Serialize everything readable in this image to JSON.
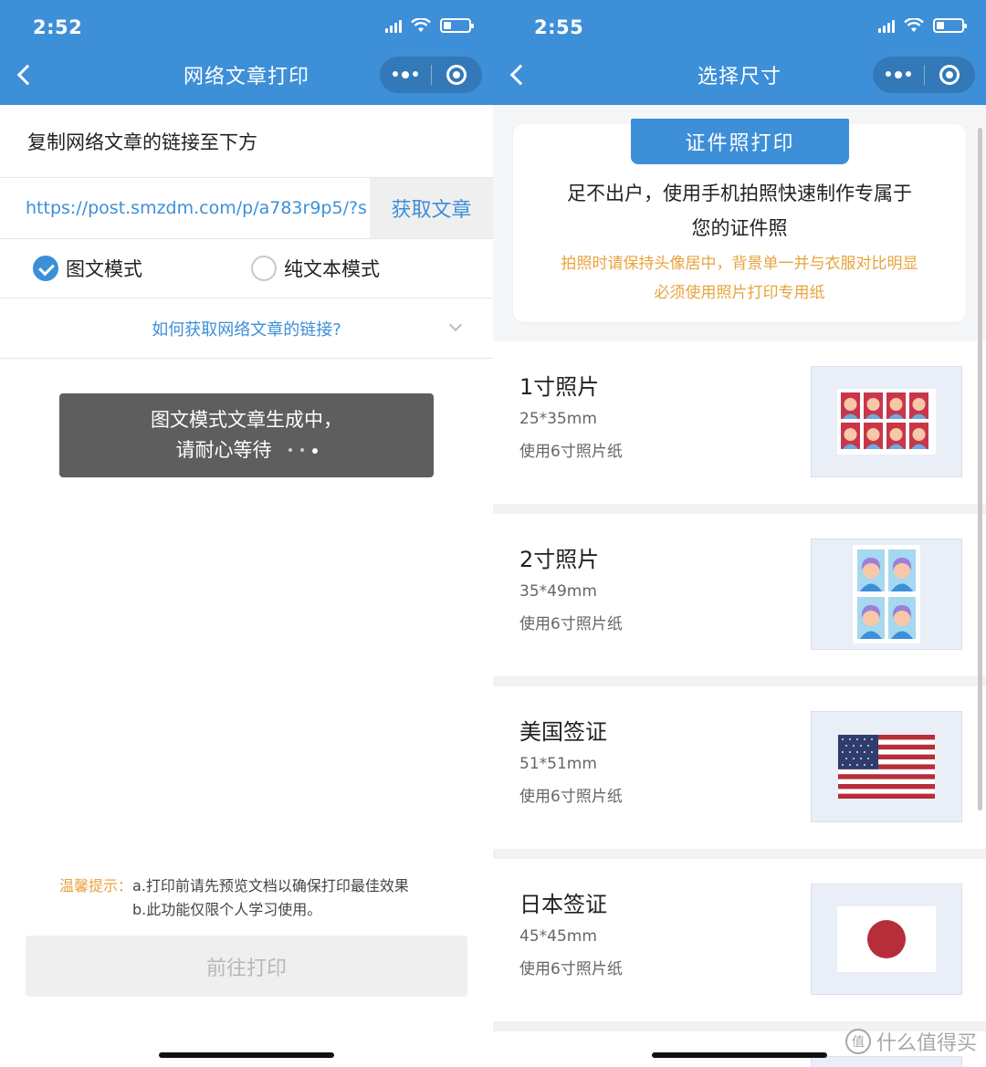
{
  "left": {
    "status": {
      "time": "2:52"
    },
    "nav": {
      "title": "网络文章打印"
    },
    "copy_label": "复制网络文章的链接至下方",
    "url_input": {
      "value": "https://post.smzdm.com/p/a783r9p5/?s"
    },
    "fetch_button": "获取文章",
    "modes": [
      {
        "label": "图文模式",
        "selected": true
      },
      {
        "label": "纯文本模式",
        "selected": false
      }
    ],
    "howto_link": "如何获取网络文章的链接?",
    "toast": {
      "line1": "图文模式文章生成中，",
      "line2": "请耐心等待"
    },
    "tips": {
      "label": "温馨提示：",
      "line1": "a.打印前请先预览文档以确保打印最佳效果",
      "line2": "b.此功能仅限个人学习使用。"
    },
    "print_button": "前往打印"
  },
  "right": {
    "status": {
      "time": "2:55"
    },
    "nav": {
      "title": "选择尺寸"
    },
    "intro": {
      "badge": "证件照打印",
      "desc_line1": "足不出户，使用手机拍照快速制作专属于",
      "desc_line2": "您的证件照",
      "warn_line1": "拍照时请保持头像居中，背景单一并与衣服对比明显",
      "warn_line2": "必须使用照片打印专用纸"
    },
    "sizes": [
      {
        "name": "1寸照片",
        "dim": "25*35mm",
        "paper": "使用6寸照片纸",
        "thumb": "id-photo-grid-1inch"
      },
      {
        "name": "2寸照片",
        "dim": "35*49mm",
        "paper": "使用6寸照片纸",
        "thumb": "id-photo-grid-2inch"
      },
      {
        "name": "美国签证",
        "dim": "51*51mm",
        "paper": "使用6寸照片纸",
        "thumb": "us-flag"
      },
      {
        "name": "日本签证",
        "dim": "45*45mm",
        "paper": "使用6寸照片纸",
        "thumb": "japan-flag"
      }
    ],
    "watermark": "什么值得买",
    "watermark_logo": "值"
  },
  "colors": {
    "brand_blue": "#3d8fd8",
    "warn_orange": "#e8a33c",
    "toast_bg": "#5e5e5e"
  }
}
